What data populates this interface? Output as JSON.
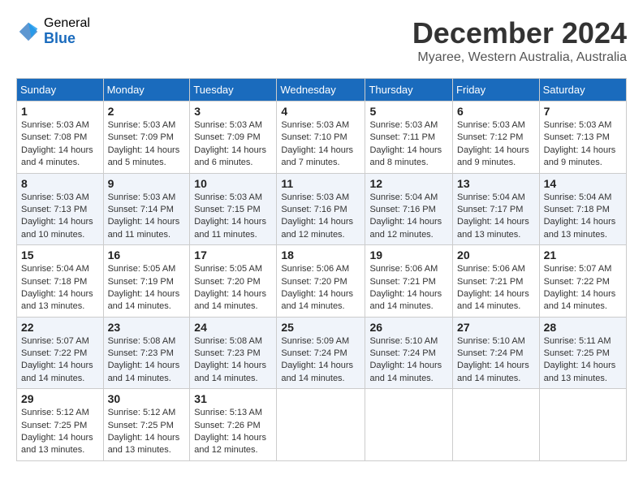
{
  "logo": {
    "general": "General",
    "blue": "Blue"
  },
  "title": "December 2024",
  "location": "Myaree, Western Australia, Australia",
  "days_of_week": [
    "Sunday",
    "Monday",
    "Tuesday",
    "Wednesday",
    "Thursday",
    "Friday",
    "Saturday"
  ],
  "weeks": [
    [
      {
        "day": "1",
        "sunrise": "5:03 AM",
        "sunset": "7:08 PM",
        "daylight": "14 hours and 4 minutes."
      },
      {
        "day": "2",
        "sunrise": "5:03 AM",
        "sunset": "7:09 PM",
        "daylight": "14 hours and 5 minutes."
      },
      {
        "day": "3",
        "sunrise": "5:03 AM",
        "sunset": "7:09 PM",
        "daylight": "14 hours and 6 minutes."
      },
      {
        "day": "4",
        "sunrise": "5:03 AM",
        "sunset": "7:10 PM",
        "daylight": "14 hours and 7 minutes."
      },
      {
        "day": "5",
        "sunrise": "5:03 AM",
        "sunset": "7:11 PM",
        "daylight": "14 hours and 8 minutes."
      },
      {
        "day": "6",
        "sunrise": "5:03 AM",
        "sunset": "7:12 PM",
        "daylight": "14 hours and 9 minutes."
      },
      {
        "day": "7",
        "sunrise": "5:03 AM",
        "sunset": "7:13 PM",
        "daylight": "14 hours and 9 minutes."
      }
    ],
    [
      {
        "day": "8",
        "sunrise": "5:03 AM",
        "sunset": "7:13 PM",
        "daylight": "14 hours and 10 minutes."
      },
      {
        "day": "9",
        "sunrise": "5:03 AM",
        "sunset": "7:14 PM",
        "daylight": "14 hours and 11 minutes."
      },
      {
        "day": "10",
        "sunrise": "5:03 AM",
        "sunset": "7:15 PM",
        "daylight": "14 hours and 11 minutes."
      },
      {
        "day": "11",
        "sunrise": "5:03 AM",
        "sunset": "7:16 PM",
        "daylight": "14 hours and 12 minutes."
      },
      {
        "day": "12",
        "sunrise": "5:04 AM",
        "sunset": "7:16 PM",
        "daylight": "14 hours and 12 minutes."
      },
      {
        "day": "13",
        "sunrise": "5:04 AM",
        "sunset": "7:17 PM",
        "daylight": "14 hours and 13 minutes."
      },
      {
        "day": "14",
        "sunrise": "5:04 AM",
        "sunset": "7:18 PM",
        "daylight": "14 hours and 13 minutes."
      }
    ],
    [
      {
        "day": "15",
        "sunrise": "5:04 AM",
        "sunset": "7:18 PM",
        "daylight": "14 hours and 13 minutes."
      },
      {
        "day": "16",
        "sunrise": "5:05 AM",
        "sunset": "7:19 PM",
        "daylight": "14 hours and 14 minutes."
      },
      {
        "day": "17",
        "sunrise": "5:05 AM",
        "sunset": "7:20 PM",
        "daylight": "14 hours and 14 minutes."
      },
      {
        "day": "18",
        "sunrise": "5:06 AM",
        "sunset": "7:20 PM",
        "daylight": "14 hours and 14 minutes."
      },
      {
        "day": "19",
        "sunrise": "5:06 AM",
        "sunset": "7:21 PM",
        "daylight": "14 hours and 14 minutes."
      },
      {
        "day": "20",
        "sunrise": "5:06 AM",
        "sunset": "7:21 PM",
        "daylight": "14 hours and 14 minutes."
      },
      {
        "day": "21",
        "sunrise": "5:07 AM",
        "sunset": "7:22 PM",
        "daylight": "14 hours and 14 minutes."
      }
    ],
    [
      {
        "day": "22",
        "sunrise": "5:07 AM",
        "sunset": "7:22 PM",
        "daylight": "14 hours and 14 minutes."
      },
      {
        "day": "23",
        "sunrise": "5:08 AM",
        "sunset": "7:23 PM",
        "daylight": "14 hours and 14 minutes."
      },
      {
        "day": "24",
        "sunrise": "5:08 AM",
        "sunset": "7:23 PM",
        "daylight": "14 hours and 14 minutes."
      },
      {
        "day": "25",
        "sunrise": "5:09 AM",
        "sunset": "7:24 PM",
        "daylight": "14 hours and 14 minutes."
      },
      {
        "day": "26",
        "sunrise": "5:10 AM",
        "sunset": "7:24 PM",
        "daylight": "14 hours and 14 minutes."
      },
      {
        "day": "27",
        "sunrise": "5:10 AM",
        "sunset": "7:24 PM",
        "daylight": "14 hours and 14 minutes."
      },
      {
        "day": "28",
        "sunrise": "5:11 AM",
        "sunset": "7:25 PM",
        "daylight": "14 hours and 13 minutes."
      }
    ],
    [
      {
        "day": "29",
        "sunrise": "5:12 AM",
        "sunset": "7:25 PM",
        "daylight": "14 hours and 13 minutes."
      },
      {
        "day": "30",
        "sunrise": "5:12 AM",
        "sunset": "7:25 PM",
        "daylight": "14 hours and 13 minutes."
      },
      {
        "day": "31",
        "sunrise": "5:13 AM",
        "sunset": "7:26 PM",
        "daylight": "14 hours and 12 minutes."
      },
      null,
      null,
      null,
      null
    ]
  ]
}
